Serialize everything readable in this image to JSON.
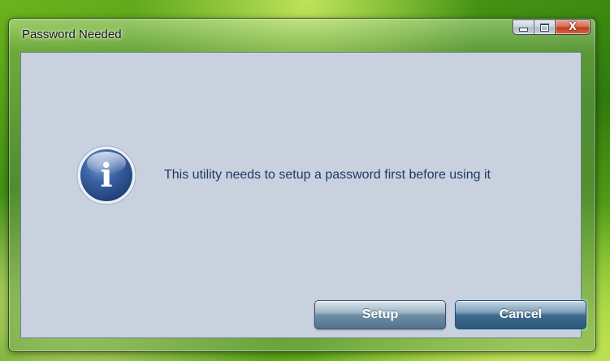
{
  "window": {
    "title": "Password Needed"
  },
  "caption_buttons": {
    "minimize_icon": "minimize-icon",
    "maximize_icon": "maximize-icon",
    "close_icon": "close-icon",
    "close_glyph": "X"
  },
  "dialog": {
    "icon": "info-icon",
    "icon_glyph": "i",
    "message": "This utility needs to setup a password first before using it"
  },
  "buttons": {
    "setup_label": "Setup",
    "cancel_label": "Cancel"
  },
  "colors": {
    "client_background": "#c9d1de",
    "message_text": "#1f3a66",
    "close_button_red": "#c0391b",
    "info_icon_blue": "#2c4f86",
    "desktop_green": "#3f8d12"
  }
}
